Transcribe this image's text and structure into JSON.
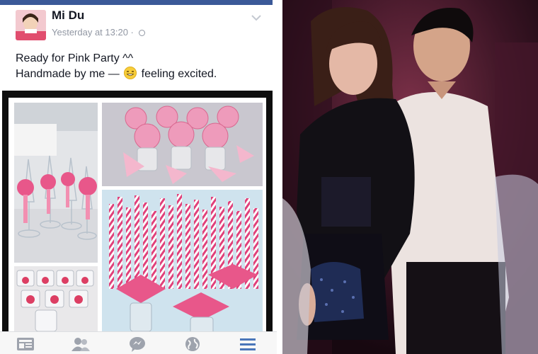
{
  "post": {
    "author": "Mi Du",
    "timestamp": "Yesterday at 13:20 ·",
    "line1": "Ready for Pink Party ^^",
    "line2_before": "Handmade by me —",
    "line2_after": "feeling excited.",
    "privacy_icon": "globe-icon",
    "menu_icon": "chevron-down-icon"
  },
  "bottom_nav": {
    "items": [
      "news-feed-icon",
      "friends-icon",
      "messenger-icon",
      "globe-icon",
      "menu-icon"
    ]
  },
  "colors": {
    "facebook_blue": "#3b5998",
    "pink": "#e8578a",
    "active_nav": "#4a76b9"
  }
}
